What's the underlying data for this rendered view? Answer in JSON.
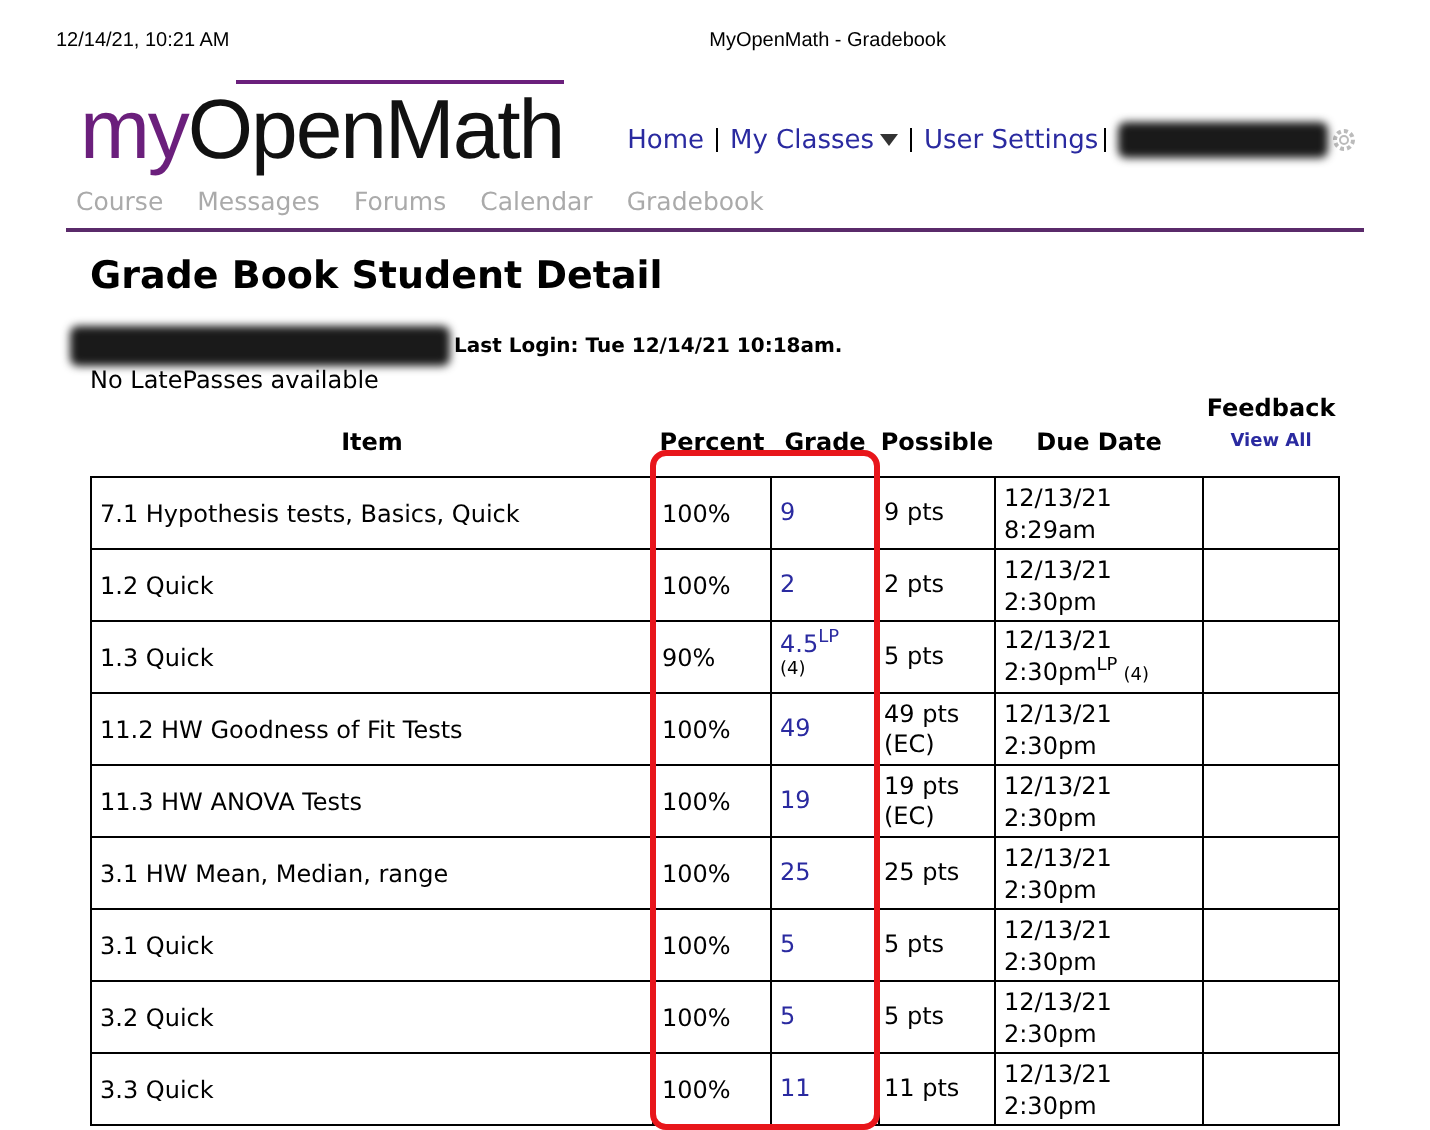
{
  "print_header": {
    "timestamp": "12/14/21, 10:21 AM",
    "title": "MyOpenMath - Gradebook"
  },
  "logo": {
    "prefix": "my",
    "name": "OpenMath"
  },
  "nav": [
    {
      "label": "Home",
      "dropdown": false
    },
    {
      "label": "My Classes",
      "dropdown": true
    },
    {
      "label": "User Settings",
      "dropdown": false
    }
  ],
  "tabs": [
    "Course",
    "Messages",
    "Forums",
    "Calendar",
    "Gradebook"
  ],
  "page_title": "Grade Book Student Detail",
  "last_login": "Last Login: Tue 12/14/21 10:18am.",
  "latepasses": "No LatePasses available",
  "columns": [
    {
      "label": "Item",
      "highlighted": false
    },
    {
      "label": "Percent",
      "highlighted": true
    },
    {
      "label": "Grade",
      "highlighted": true
    },
    {
      "label": "Possible",
      "highlighted": false
    },
    {
      "label": "Due Date",
      "highlighted": false
    },
    {
      "label": "Feedback",
      "link": "View All",
      "highlighted": false
    }
  ],
  "rows": [
    {
      "item": "7.1 Hypothesis tests, Basics, Quick",
      "percent": "100%",
      "grade": "9",
      "possible": "9 pts",
      "due_date": "12/13/21",
      "due_time": "8:29am"
    },
    {
      "item": "1.2 Quick",
      "percent": "100%",
      "grade": "2",
      "possible": "2 pts",
      "due_date": "12/13/21",
      "due_time": "2:30pm"
    },
    {
      "item": "1.3 Quick",
      "percent": "90%",
      "grade": "4.5$^{LP}$",
      "grade_note": "(4)",
      "possible": "5 pts",
      "due_date": "12/13/21",
      "due_time": "2:30pm$^{LP}$",
      "due_note": "(4)"
    },
    {
      "item": "11.2 HW Goodness of Fit Tests",
      "percent": "100%",
      "grade": "49",
      "possible": "49 pts (EC)",
      "due_date": "12/13/21",
      "due_time": "2:30pm"
    },
    {
      "item": "11.3 HW ANOVA Tests",
      "percent": "100%",
      "grade": "19",
      "possible": "19 pts (EC)",
      "due_date": "12/13/21",
      "due_time": "2:30pm"
    },
    {
      "item": "3.1 HW Mean, Median, range",
      "percent": "100%",
      "grade": "25",
      "possible": "25 pts",
      "due_date": "12/13/21",
      "due_time": "2:30pm"
    },
    {
      "item": "3.1 Quick",
      "percent": "100%",
      "grade": "5",
      "possible": "5 pts",
      "due_date": "12/13/21",
      "due_time": "2:30pm"
    },
    {
      "item": "3.2 Quick",
      "percent": "100%",
      "grade": "5",
      "possible": "5 pts",
      "due_date": "12/13/21",
      "due_time": "2:30pm"
    },
    {
      "item": "3.3 Quick",
      "percent": "100%",
      "grade": "11",
      "possible": "11 pts",
      "due_date": "12/13/21",
      "due_time": "2:30pm"
    }
  ]
}
